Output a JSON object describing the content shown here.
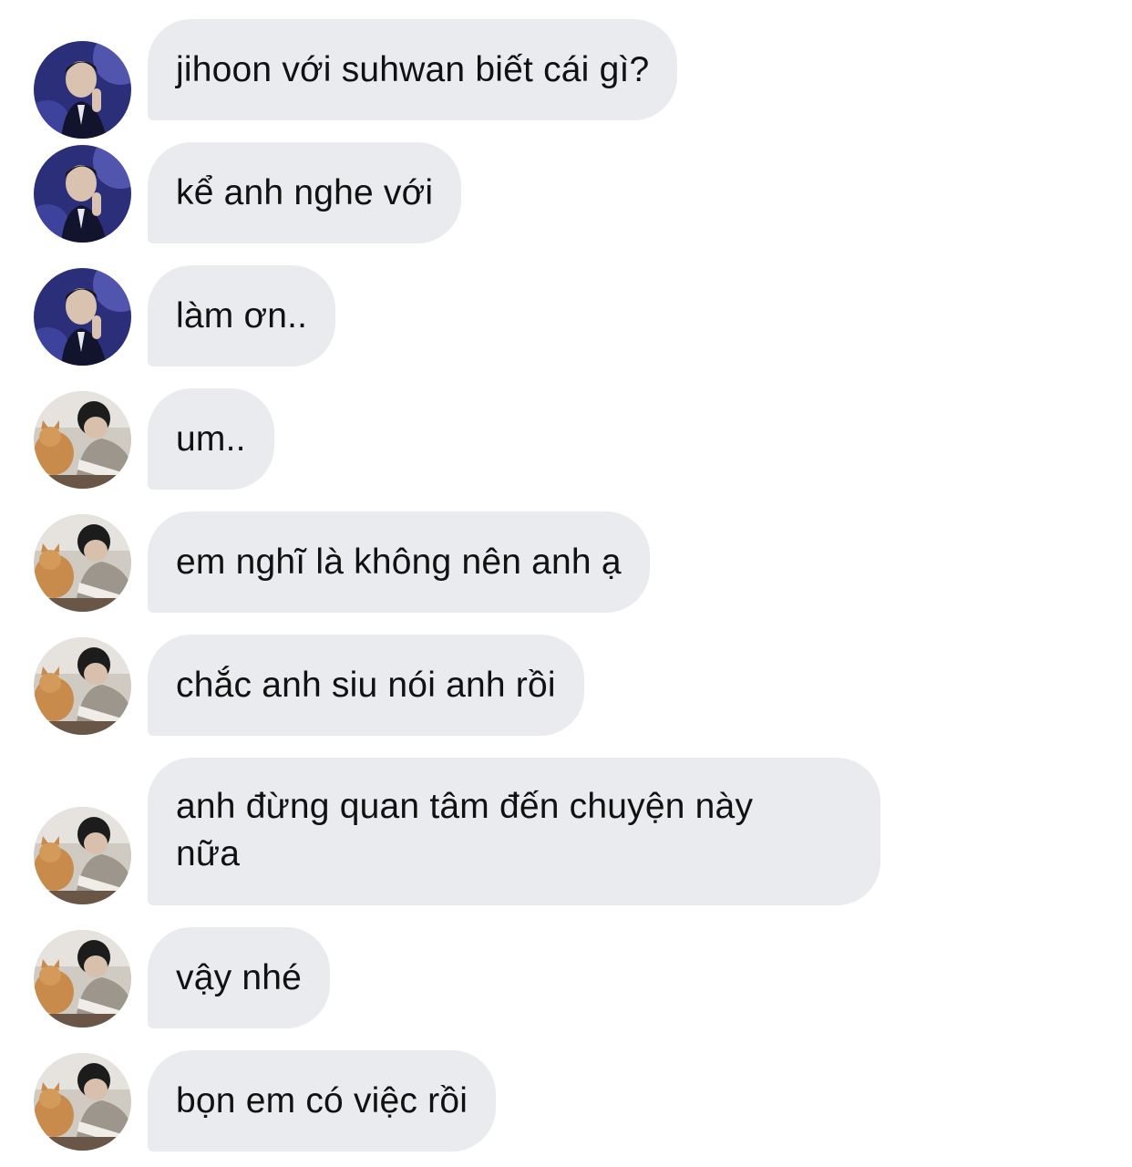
{
  "conversation": {
    "messages": [
      {
        "sender": "a",
        "text": "jihoon với suhwan biết cái gì?"
      },
      {
        "sender": "a",
        "text": "kể anh nghe với"
      },
      {
        "sender": "a",
        "text": "làm ơn.."
      },
      {
        "sender": "b",
        "text": "um.."
      },
      {
        "sender": "b",
        "text": "em nghĩ là không nên anh ạ"
      },
      {
        "sender": "b",
        "text": "chắc anh siu nói anh rồi"
      },
      {
        "sender": "b",
        "text": "anh đừng quan tâm đến chuyện này\nnữa"
      },
      {
        "sender": "b",
        "text": "vậy nhé"
      },
      {
        "sender": "b",
        "text": "bọn em có việc rồi"
      }
    ]
  },
  "colors": {
    "bubble": "#e9ebef",
    "text": "#111111",
    "background": "#ffffff"
  },
  "icons": {
    "avatar_a": "avatar-suit-man-icon",
    "avatar_b": "avatar-man-with-cat-icon"
  }
}
